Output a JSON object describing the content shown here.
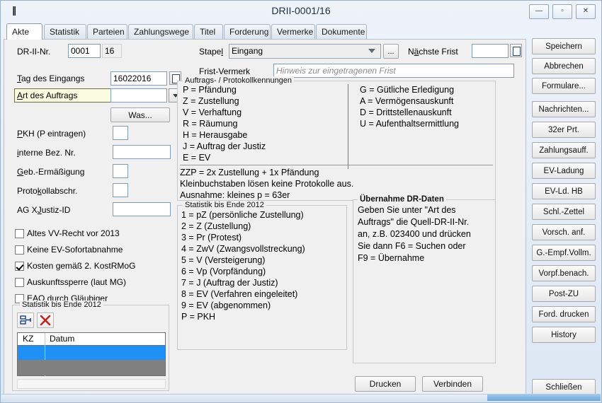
{
  "window": {
    "title": "DRII-0001/16",
    "icon": "pause-bars-icon",
    "buttons": {
      "minimize": "—",
      "maximize": "▫",
      "close": "✕"
    }
  },
  "tabs": [
    {
      "label": "Akte",
      "active": true
    },
    {
      "label": "Statistik",
      "active": false
    },
    {
      "label": "Parteien",
      "active": false
    },
    {
      "label": "Zahlungswege",
      "active": false
    },
    {
      "label": "Titel",
      "active": false
    },
    {
      "label": "Forderung",
      "active": false
    },
    {
      "label": "Vermerke",
      "active": false
    },
    {
      "label": "Dokumente",
      "active": false
    }
  ],
  "form": {
    "dr_nr_label": "DR-II-Nr.",
    "dr_nr_value": "0001",
    "dr_nr_year": "16",
    "tag_des_eingangs_label": "Tag des Eingangs",
    "tag_des_eingangs_value": "16022016",
    "art_des_auftrags_label": "Art des Auftrags",
    "art_des_auftrags_value": "",
    "was_button": "Was...",
    "pkh_label": "PKH (P eintragen)",
    "pkh_value": "",
    "interne_bez_label": "interne Bez. Nr.",
    "interne_bez_value": "",
    "geb_ermaessigung_label": "Geb.-Ermäßigung",
    "geb_ermaessigung_value": "",
    "protokollabschr_label": "Protokollabschr.",
    "protokollabschr_value": "",
    "ag_xjustiz_label": "AG XJustiz-ID",
    "ag_xjustiz_value": "",
    "stapel_label": "Stapel",
    "stapel_value": "Eingang",
    "stapel_more_button": "...",
    "naechste_frist_label": "Nächste Frist",
    "naechste_frist_value": "",
    "frist_vermerk_label": "Frist-Vermerk",
    "frist_vermerk_value": "",
    "frist_vermerk_placeholder": "Hinweis zur eingetragenen Frist"
  },
  "checkboxes": [
    {
      "label": "Altes VV-Recht vor 2013",
      "checked": false
    },
    {
      "label": "Keine EV-Sofortabnahme",
      "checked": false
    },
    {
      "label": "Kosten gemäß 2. KostRMoG",
      "checked": true
    },
    {
      "label": "Auskunftssperre (laut MG)",
      "checked": false
    },
    {
      "label": "EAO durch Gläubiger",
      "checked": false
    }
  ],
  "statistik_box": {
    "title": "Statistik bis Ende 2012",
    "add_icon": "insert-row-icon",
    "delete_icon": "red-x-delete-icon",
    "columns": [
      "KZ",
      "Datum"
    ],
    "rows": [
      {
        "KZ": "",
        "Datum": "",
        "selected": true
      },
      {
        "KZ": "",
        "Datum": "",
        "selected": false
      }
    ]
  },
  "kennungen_box": {
    "title": "Auftrags- / Protokollkennungen",
    "left_column": [
      "P = Pfändung",
      "Z = Zustellung",
      "V = Verhaftung",
      "R = Räumung",
      "H = Herausgabe",
      "J = Auftrag der Justiz",
      "E = EV"
    ],
    "right_column": [
      "G = Gütliche Erledigung",
      "A = Vermögensauskunft",
      "D = Drittstellenauskunft",
      "U = Aufenthaltsermittlung"
    ],
    "footer": [
      "ZZP = 2x Zustellung + 1x Pfändung",
      "Kleinbuchstaben lösen keine Protokolle aus.",
      "Ausnahme: kleines p = 63er"
    ]
  },
  "statistik_legend": {
    "title": "Statistik bis Ende 2012",
    "items": [
      "1 = pZ (persönliche Zustellung)",
      "2 = Z (Zustellung)",
      "3 = Pr (Protest)",
      "4 = ZwV (Zwangsvollstreckung)",
      "5 = V (Versteigerung)",
      "6 = Vp (Vorpfändung)",
      "7 = J (Auftrag der Justiz)",
      "8 = EV (Verfahren eingeleitet)",
      "9 = EV (abgenommen)",
      "P = PKH"
    ]
  },
  "uebernahme_box": {
    "title": "Übernahme DR-Daten",
    "lines": [
      "Geben Sie unter \"Art des",
      "Auftrags\" die Quell-DR-II-Nr.",
      "an, z.B. 023400 und drücken",
      "Sie dann F6 = Suchen oder",
      "F9 = Übernahme"
    ],
    "print_button": "Drucken",
    "connect_button": "Verbinden"
  },
  "sidebar": {
    "buttons": [
      "Speichern",
      "Abbrechen",
      "Formulare...",
      "Nachrichten...",
      "32er Prt.",
      "Zahlungsauff.",
      "EV-Ladung",
      "EV-Ld. HB",
      "Schl.-Zettel",
      "Vorsch. anf.",
      "G.-Empf.Vollm.",
      "Vorpf.benach.",
      "Post-ZU",
      "Ford. drucken",
      "History"
    ],
    "close_button": "Schließen"
  },
  "colors": {
    "accent": "#1e90f6",
    "highlight_field": "#fbfbe0",
    "window_bg": "#f0f0f0",
    "title_bg": "#e6eef8"
  }
}
